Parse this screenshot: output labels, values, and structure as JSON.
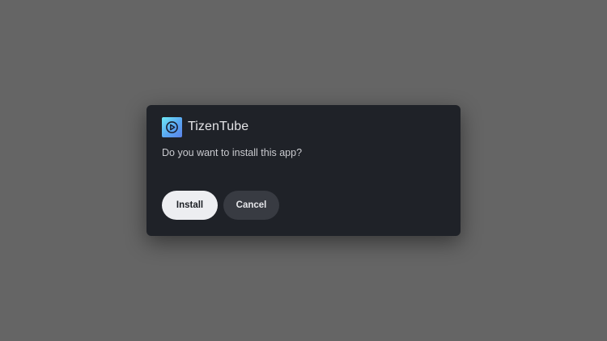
{
  "dialog": {
    "app_name": "TizenTube",
    "app_icon": "tizentube-play-icon",
    "message": "Do you want to install this app?",
    "install_label": "Install",
    "cancel_label": "Cancel"
  },
  "colors": {
    "backdrop": "#656565",
    "dialog_bg": "#1f2228",
    "primary_button_bg": "#edeef1",
    "secondary_button_bg": "#383b42"
  }
}
